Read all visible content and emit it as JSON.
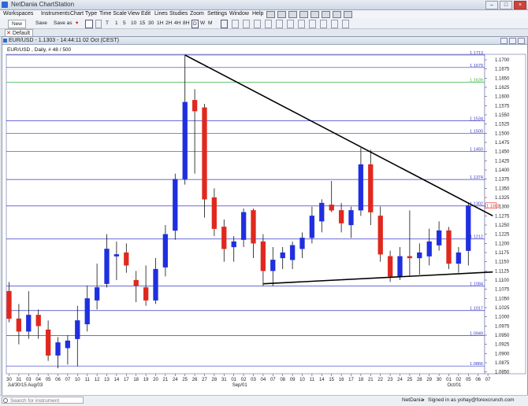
{
  "app": {
    "title": "NetDania ChartStation"
  },
  "menu": [
    "Workspaces",
    "Instruments",
    "Chart Type",
    "Time Scale",
    "View",
    "Edit",
    "Lines",
    "Studies",
    "Zoom",
    "Settings",
    "Window",
    "Help"
  ],
  "toolbar": {
    "new_label": "New",
    "save_label": "Save",
    "save_as_label": "Save as",
    "tools": [
      "T",
      "1",
      "5",
      "10",
      "15",
      "30",
      "1H",
      "2H",
      "4H",
      "8H",
      "D",
      "W",
      "M"
    ],
    "selected_tool": "D"
  },
  "tabs": [
    {
      "label": "Default"
    }
  ],
  "window": {
    "title": "EUR/USD - 1.1303 - 14:44:11 02 Oct (CEST)"
  },
  "chart_label": "EUR/USD , Daily, # 48 / 500",
  "statusbar": {
    "search_placeholder": "Search for instrument",
    "provider": "NetDania",
    "signed_in": "Signed in as yohay@forexcrunch.com"
  },
  "chart_data": {
    "type": "candlestick",
    "ylim": [
      1.0845,
      1.1715
    ],
    "price_ticks": [
      "1.1700",
      "1.1675",
      "1.1650",
      "1.1625",
      "1.1600",
      "1.1575",
      "1.1550",
      "1.1525",
      "1.1500",
      "1.1475",
      "1.1450",
      "1.1425",
      "1.1400",
      "1.1375",
      "1.1350",
      "1.1325",
      "1.1300",
      "1.1275",
      "1.1250",
      "1.1225",
      "1.1200",
      "1.1175",
      "1.1150",
      "1.1125",
      "1.1100",
      "1.1075",
      "1.1050",
      "1.1025",
      "1.1000",
      "1.0975",
      "1.0950",
      "1.0925",
      "1.0900",
      "1.0875",
      "1.0850"
    ],
    "horizontal_levels": [
      {
        "value": 1.1713,
        "label": "1.1713",
        "color": "#3a3ac8"
      },
      {
        "value": 1.1679,
        "label": "1.1679",
        "color": "#3a3ac8"
      },
      {
        "value": 1.1639,
        "label": "1.1639",
        "color": "#3bb34a"
      },
      {
        "value": 1.1534,
        "label": "1.1534",
        "color": "#3a3ac8"
      },
      {
        "value": 1.15,
        "label": "1.1500",
        "color": "#3a3ac8"
      },
      {
        "value": 1.145,
        "label": "1.1450",
        "color": "#3a3ac8"
      },
      {
        "value": 1.1374,
        "label": "1.1374",
        "color": "#3a3ac8"
      },
      {
        "value": 1.1302,
        "label": "1.1302",
        "color": "#3a3ac8"
      },
      {
        "value": 1.1212,
        "label": "1.1212",
        "color": "#3a3ac8"
      },
      {
        "value": 1.1084,
        "label": "1.1084",
        "color": "#3a3ac8"
      },
      {
        "value": 1.1017,
        "label": "1.1017",
        "color": "#3a3ac8"
      },
      {
        "value": 1.0949,
        "label": "1.0949",
        "color": "#3a3ac8"
      },
      {
        "value": 1.0866,
        "label": "1.0866",
        "color": "#3a3ac8"
      }
    ],
    "current_price": {
      "value": 1.1303,
      "label": "1.1303"
    },
    "x_ticks": [
      "30",
      "31",
      "03",
      "04",
      "05",
      "06",
      "07",
      "10",
      "11",
      "12",
      "13",
      "14",
      "17",
      "18",
      "19",
      "20",
      "21",
      "24",
      "25",
      "26",
      "27",
      "28",
      "31",
      "01",
      "02",
      "03",
      "04",
      "07",
      "08",
      "09",
      "10",
      "11",
      "14",
      "15",
      "16",
      "17",
      "18",
      "21",
      "22",
      "23",
      "24",
      "25",
      "28",
      "29",
      "30",
      "01",
      "02",
      "05",
      "06",
      "07"
    ],
    "x_month_labels": [
      {
        "at": 0,
        "text": "Jul/30/15 Aug/03"
      },
      {
        "at": 23,
        "text": "Sep/01"
      },
      {
        "at": 45,
        "text": "Oct/01"
      }
    ],
    "candles": [
      {
        "o": 1.107,
        "h": 1.1095,
        "l": 1.0985,
        "c": 1.0995
      },
      {
        "o": 1.0995,
        "h": 1.1035,
        "l": 1.0925,
        "c": 1.096
      },
      {
        "o": 1.096,
        "h": 1.107,
        "l": 1.094,
        "c": 1.1005
      },
      {
        "o": 1.1005,
        "h": 1.102,
        "l": 1.094,
        "c": 1.0975
      },
      {
        "o": 1.0965,
        "h": 1.099,
        "l": 1.088,
        "c": 1.0895
      },
      {
        "o": 1.0895,
        "h": 1.0945,
        "l": 1.086,
        "c": 1.093
      },
      {
        "o": 1.0915,
        "h": 1.095,
        "l": 1.087,
        "c": 1.0935
      },
      {
        "o": 1.094,
        "h": 1.103,
        "l": 1.0865,
        "c": 1.099
      },
      {
        "o": 1.098,
        "h": 1.1085,
        "l": 1.096,
        "c": 1.105
      },
      {
        "o": 1.1045,
        "h": 1.1145,
        "l": 1.102,
        "c": 1.108
      },
      {
        "o": 1.109,
        "h": 1.1225,
        "l": 1.108,
        "c": 1.1185
      },
      {
        "o": 1.1165,
        "h": 1.1205,
        "l": 1.11,
        "c": 1.117
      },
      {
        "o": 1.1175,
        "h": 1.12,
        "l": 1.112,
        "c": 1.114
      },
      {
        "o": 1.11,
        "h": 1.1125,
        "l": 1.104,
        "c": 1.1085
      },
      {
        "o": 1.108,
        "h": 1.114,
        "l": 1.103,
        "c": 1.1045
      },
      {
        "o": 1.1045,
        "h": 1.116,
        "l": 1.1035,
        "c": 1.113
      },
      {
        "o": 1.1135,
        "h": 1.125,
        "l": 1.111,
        "c": 1.1225
      },
      {
        "o": 1.1235,
        "h": 1.139,
        "l": 1.121,
        "c": 1.1375
      },
      {
        "o": 1.1375,
        "h": 1.1713,
        "l": 1.136,
        "c": 1.1585
      },
      {
        "o": 1.159,
        "h": 1.162,
        "l": 1.139,
        "c": 1.156
      },
      {
        "o": 1.157,
        "h": 1.158,
        "l": 1.127,
        "c": 1.132
      },
      {
        "o": 1.1325,
        "h": 1.135,
        "l": 1.122,
        "c": 1.124
      },
      {
        "o": 1.1245,
        "h": 1.1265,
        "l": 1.115,
        "c": 1.1185
      },
      {
        "o": 1.119,
        "h": 1.122,
        "l": 1.115,
        "c": 1.1205
      },
      {
        "o": 1.121,
        "h": 1.1295,
        "l": 1.119,
        "c": 1.1285
      },
      {
        "o": 1.129,
        "h": 1.1295,
        "l": 1.116,
        "c": 1.12
      },
      {
        "o": 1.1205,
        "h": 1.1225,
        "l": 1.1084,
        "c": 1.1125
      },
      {
        "o": 1.1125,
        "h": 1.119,
        "l": 1.1084,
        "c": 1.1155
      },
      {
        "o": 1.116,
        "h": 1.119,
        "l": 1.113,
        "c": 1.1175
      },
      {
        "o": 1.1155,
        "h": 1.1205,
        "l": 1.113,
        "c": 1.1195
      },
      {
        "o": 1.1185,
        "h": 1.123,
        "l": 1.116,
        "c": 1.1215
      },
      {
        "o": 1.1215,
        "h": 1.13,
        "l": 1.12,
        "c": 1.1275
      },
      {
        "o": 1.126,
        "h": 1.132,
        "l": 1.123,
        "c": 1.131
      },
      {
        "o": 1.1305,
        "h": 1.137,
        "l": 1.1285,
        "c": 1.129
      },
      {
        "o": 1.129,
        "h": 1.131,
        "l": 1.123,
        "c": 1.1255
      },
      {
        "o": 1.125,
        "h": 1.13,
        "l": 1.1215,
        "c": 1.129
      },
      {
        "o": 1.129,
        "h": 1.146,
        "l": 1.1275,
        "c": 1.1415
      },
      {
        "o": 1.1415,
        "h": 1.1455,
        "l": 1.125,
        "c": 1.1285
      },
      {
        "o": 1.1275,
        "h": 1.13,
        "l": 1.115,
        "c": 1.117
      },
      {
        "o": 1.1165,
        "h": 1.118,
        "l": 1.1095,
        "c": 1.111
      },
      {
        "o": 1.111,
        "h": 1.119,
        "l": 1.11,
        "c": 1.1165
      },
      {
        "o": 1.1165,
        "h": 1.129,
        "l": 1.111,
        "c": 1.116
      },
      {
        "o": 1.116,
        "h": 1.12,
        "l": 1.1115,
        "c": 1.1175
      },
      {
        "o": 1.1165,
        "h": 1.124,
        "l": 1.114,
        "c": 1.1205
      },
      {
        "o": 1.1195,
        "h": 1.126,
        "l": 1.118,
        "c": 1.1235
      },
      {
        "o": 1.1235,
        "h": 1.1245,
        "l": 1.113,
        "c": 1.1145
      },
      {
        "o": 1.1145,
        "h": 1.119,
        "l": 1.112,
        "c": 1.1175
      },
      {
        "o": 1.118,
        "h": 1.131,
        "l": 1.114,
        "c": 1.1303
      }
    ],
    "trendlines": [
      {
        "from": {
          "i": 18,
          "price": 1.1713
        },
        "to": {
          "i": 49.5,
          "price": 1.1275
        },
        "color": "#000000"
      },
      {
        "from": {
          "i": 26,
          "price": 1.109
        },
        "to": {
          "i": 49.5,
          "price": 1.1122
        },
        "color": "#000000"
      }
    ],
    "colors": {
      "up": "#1f2fe0",
      "down": "#e0281e",
      "grid": "#7a7ad8",
      "current_tag": "#e0281e"
    }
  }
}
